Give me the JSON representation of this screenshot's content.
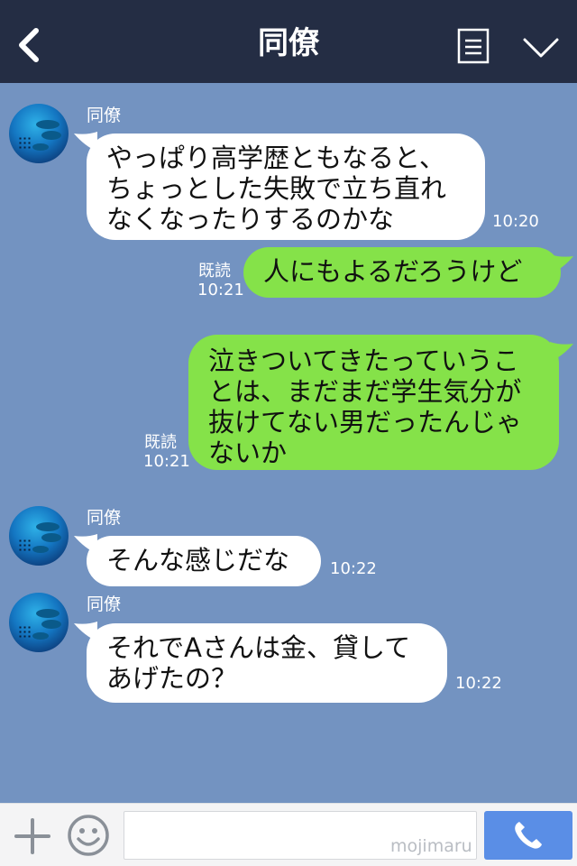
{
  "header": {
    "title": "同僚",
    "back_icon": "chevron-left-icon",
    "menu_icon": "document-icon",
    "collapse_icon": "chevron-down-icon"
  },
  "messages": [
    {
      "sender": "同僚",
      "lines": [
        "やっぱり高学歴ともなると、",
        "ちょっとした失敗で立ち直れ",
        "なくなったりするのかな"
      ],
      "time": "10:20"
    },
    {
      "lines": [
        "人にもよるだろうけど"
      ],
      "read": "既読",
      "time": "10:21"
    },
    {
      "lines": [
        "泣きついてきたっていうこ",
        "とは、まだまだ学生気分が",
        "抜けてない男だったんじゃ",
        "ないか"
      ],
      "read": "既読",
      "time": "10:21"
    },
    {
      "sender": "同僚",
      "lines": [
        "そんな感じだな"
      ],
      "time": "10:22"
    },
    {
      "sender": "同僚",
      "lines": [
        "それでAさんは金、貸して",
        "あげたの？"
      ],
      "time": "10:22"
    }
  ],
  "footer": {
    "watermark": "mojimaru",
    "plus_icon": "plus-icon",
    "sticker_icon": "smiley-icon",
    "call_icon": "phone-icon"
  },
  "colors": {
    "header_bg": "#242d44",
    "chat_bg": "#7393c1",
    "incoming_bubble": "#ffffff",
    "outgoing_bubble": "#85e249",
    "call_button": "#5a8ee6"
  }
}
